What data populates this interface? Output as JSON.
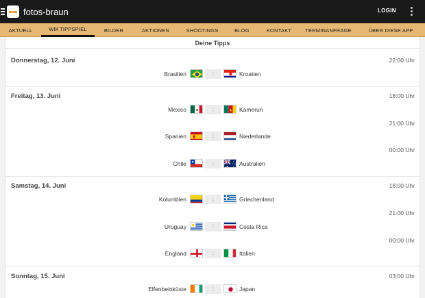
{
  "appbar": {
    "title": "fotos-braun",
    "login_label": "LOGIN"
  },
  "tabs": [
    {
      "label": "AKTUELL"
    },
    {
      "label": "WM TIPPSPIEL"
    },
    {
      "label": "BILDER"
    },
    {
      "label": "AKTIONEN"
    },
    {
      "label": "SHOOTINGS"
    },
    {
      "label": "BLOG"
    },
    {
      "label": "KONTAKT"
    },
    {
      "label": "TERMINANFRAGE"
    },
    {
      "label": "ÜBER DIESE APP"
    }
  ],
  "page": {
    "title": "Deine Tipps"
  },
  "days": [
    {
      "label": "Donnerstag, 12. Juni"
    },
    {
      "label": "Freitag, 13. Juni"
    },
    {
      "label": "Samstag, 14. Juni"
    },
    {
      "label": "Sonntag, 15. Juni"
    }
  ],
  "times": [
    "22:00 Uhr",
    "18:00 Uhr",
    "21:00 Uhr",
    "00:00 Uhr",
    "18:00 Uhr",
    "21:00 Uhr",
    "00:00 Uhr",
    "03:00 Uhr"
  ],
  "score_separator": ":",
  "matches": [
    {
      "home": "Brasilien",
      "away": "Kroatien",
      "home_flag": "brazil-flag",
      "away_flag": "croatia-flag"
    },
    {
      "home": "Mexico",
      "away": "Kamerun",
      "home_flag": "mexico-flag",
      "away_flag": "cameroon-flag"
    },
    {
      "home": "Spanien",
      "away": "Niederlande",
      "home_flag": "spain-flag",
      "away_flag": "netherlands-flag"
    },
    {
      "home": "Chile",
      "away": "Australien",
      "home_flag": "chile-flag",
      "away_flag": "australia-flag"
    },
    {
      "home": "Kolumbien",
      "away": "Griechenland",
      "home_flag": "colombia-flag",
      "away_flag": "greece-flag"
    },
    {
      "home": "Uruguay",
      "away": "Costa Rica",
      "home_flag": "uruguay-flag",
      "away_flag": "costa-rica-flag"
    },
    {
      "home": "England",
      "away": "Italien",
      "home_flag": "england-flag",
      "away_flag": "italy-flag"
    },
    {
      "home": "Elfenbeinküste",
      "away": "Japan",
      "home_flag": "ivory-coast-flag",
      "away_flag": "japan-flag"
    }
  ],
  "colors": {
    "appbar": "#1a1a1a",
    "tabbar": "#e6b873",
    "accent": "#e7a73a"
  }
}
